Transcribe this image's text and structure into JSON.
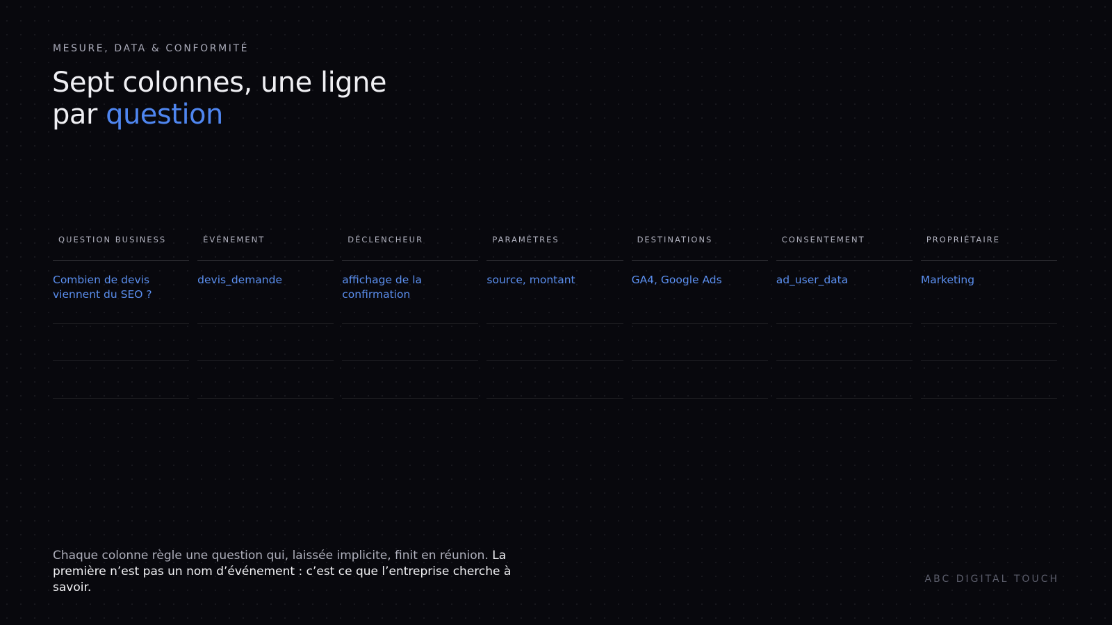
{
  "header": {
    "eyebrow": "MESURE, DATA & CONFORMITÉ",
    "title_line1": "Sept colonnes, une ligne",
    "title_line2_prefix": "par ",
    "title_line2_accent": "question"
  },
  "table": {
    "columns": [
      {
        "header": "QUESTION BUSINESS",
        "value": "Combien de devis viennent du SEO ?"
      },
      {
        "header": "ÉVÉNEMENT",
        "value": "devis_demande"
      },
      {
        "header": "DÉCLENCHEUR",
        "value": "affichage de la confirmation"
      },
      {
        "header": "PARAMÈTRES",
        "value": "source, montant"
      },
      {
        "header": "DESTINATIONS",
        "value": "GA4, Google Ads"
      },
      {
        "header": "CONSENTEMENT",
        "value": "ad_user_data"
      },
      {
        "header": "PROPRIÉTAIRE",
        "value": "Marketing"
      }
    ]
  },
  "footer": {
    "text_regular": "Chaque colonne règle une question qui, laissée implicite, finit en réunion. ",
    "text_strong": "La première n’est pas un nom d’événement : c’est ce que l’entreprise cherche à savoir.",
    "brand": "ABC DIGITAL TOUCH"
  },
  "colors": {
    "background": "#08080d",
    "accent": "#4f86f0",
    "cell_text": "#5b8fef"
  }
}
